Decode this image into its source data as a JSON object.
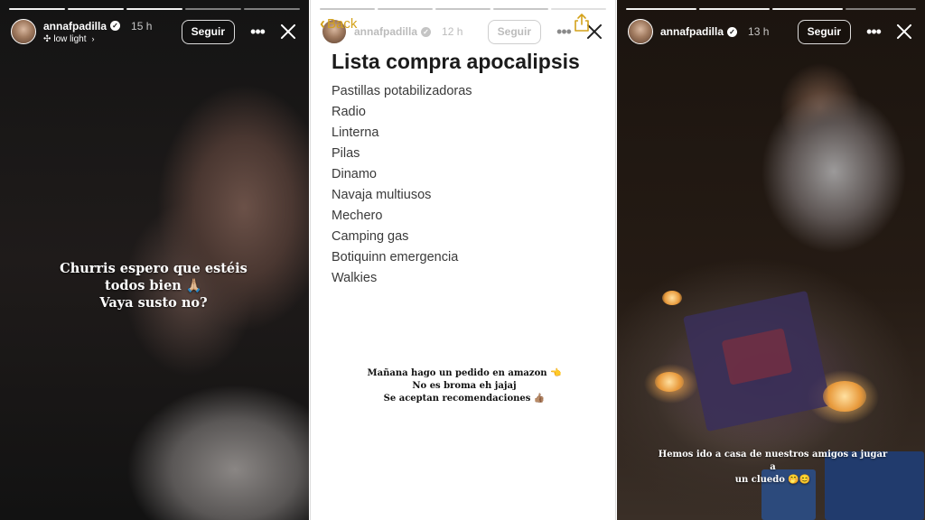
{
  "stories": [
    {
      "username": "annafpadilla",
      "time": "15 h",
      "music": "low light",
      "follow_label": "Seguir",
      "caption": [
        "Churris espero que estéis",
        "todos bien 🙏🏼",
        "Vaya susto no?"
      ]
    },
    {
      "username": "annafpadilla",
      "time": "12 h",
      "follow_label": "Seguir",
      "back_label": "Back",
      "list_title": "Lista compra apocalipsis",
      "items": [
        "Pastillas potabilizadoras",
        "Radio",
        "Linterna",
        "Pilas",
        "Dinamo",
        "Navaja multiusos",
        "Mechero",
        "Camping gas",
        "Botiquinn emergencia",
        "Walkies"
      ],
      "note": [
        "Mañana hago un pedido en amazon 👈",
        "No es broma eh jajaj",
        "Se aceptan recomendaciones 👍🏽"
      ]
    },
    {
      "username": "annafpadilla",
      "time": "13 h",
      "follow_label": "Seguir",
      "caption": [
        "Hemos ido a casa de nuestros amigos a jugar a",
        "un cluedo 🤭😊"
      ]
    }
  ],
  "colors": {
    "back_link": "#d4a21a",
    "list_title": "#1b1b1b"
  }
}
